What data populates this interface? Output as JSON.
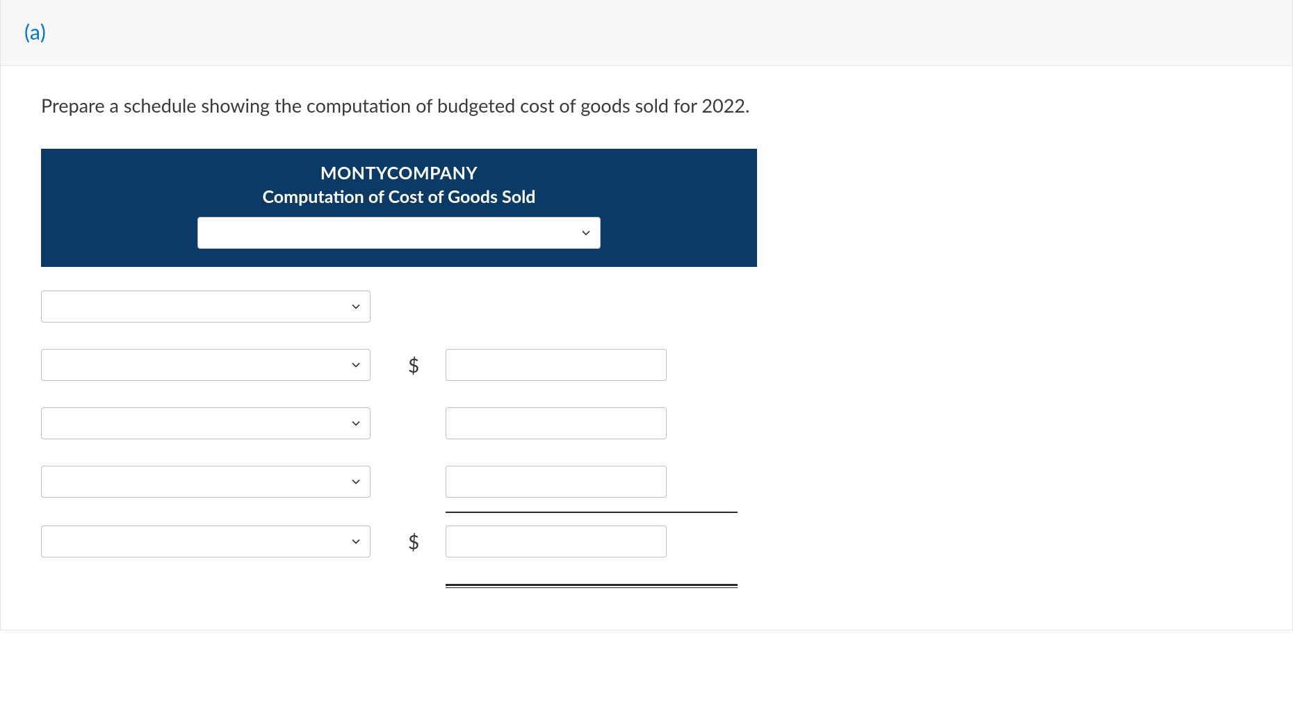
{
  "part_label": "(a)",
  "instruction": "Prepare a schedule showing the computation of budgeted cost of goods sold for 2022.",
  "schedule_header": {
    "company": "MONTYCOMPANY",
    "title": "Computation of Cost of Goods Sold",
    "period_selected": ""
  },
  "currency_symbol": "$",
  "rows": {
    "r1": {
      "label": "",
      "has_sym": false,
      "has_val": false
    },
    "r2": {
      "label": "",
      "has_sym": true,
      "has_val": true,
      "value": ""
    },
    "r3": {
      "label": "",
      "has_sym": false,
      "has_val": true,
      "value": ""
    },
    "r4": {
      "label": "",
      "has_sym": false,
      "has_val": true,
      "value": ""
    },
    "r5": {
      "label": "",
      "has_sym": true,
      "has_val": true,
      "value": ""
    }
  }
}
